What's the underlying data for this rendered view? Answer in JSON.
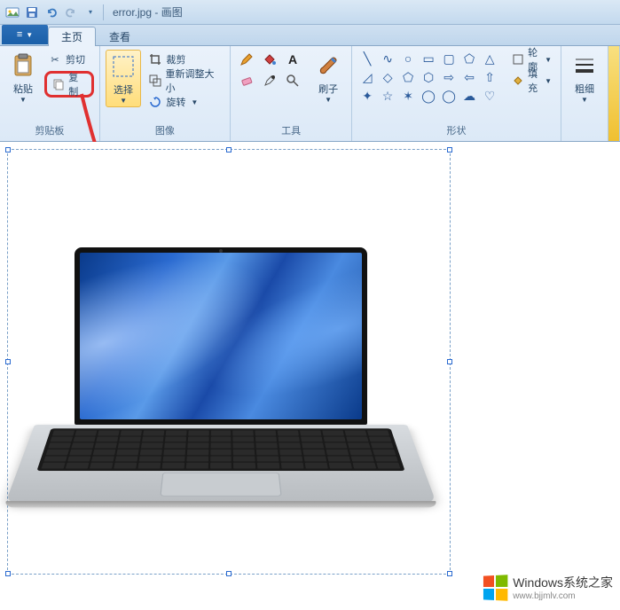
{
  "titlebar": {
    "filename": "error.jpg",
    "appname": "画图"
  },
  "tabs": {
    "file_icon": "≡",
    "home": "主页",
    "view": "查看"
  },
  "ribbon": {
    "clipboard": {
      "label": "剪贴板",
      "paste": "粘贴",
      "cut": "剪切",
      "copy": "复制"
    },
    "image": {
      "label": "图像",
      "select": "选择",
      "crop": "裁剪",
      "resize": "重新调整大小",
      "rotate": "旋转"
    },
    "tools": {
      "label": "工具",
      "brush": "刷子"
    },
    "shapes": {
      "label": "形状",
      "outline": "轮廓",
      "fill": "填充"
    },
    "thickness": {
      "label": "粗细"
    }
  },
  "watermark": {
    "main": "Windows系统之家",
    "sub": "www.bjjmlv.com"
  }
}
